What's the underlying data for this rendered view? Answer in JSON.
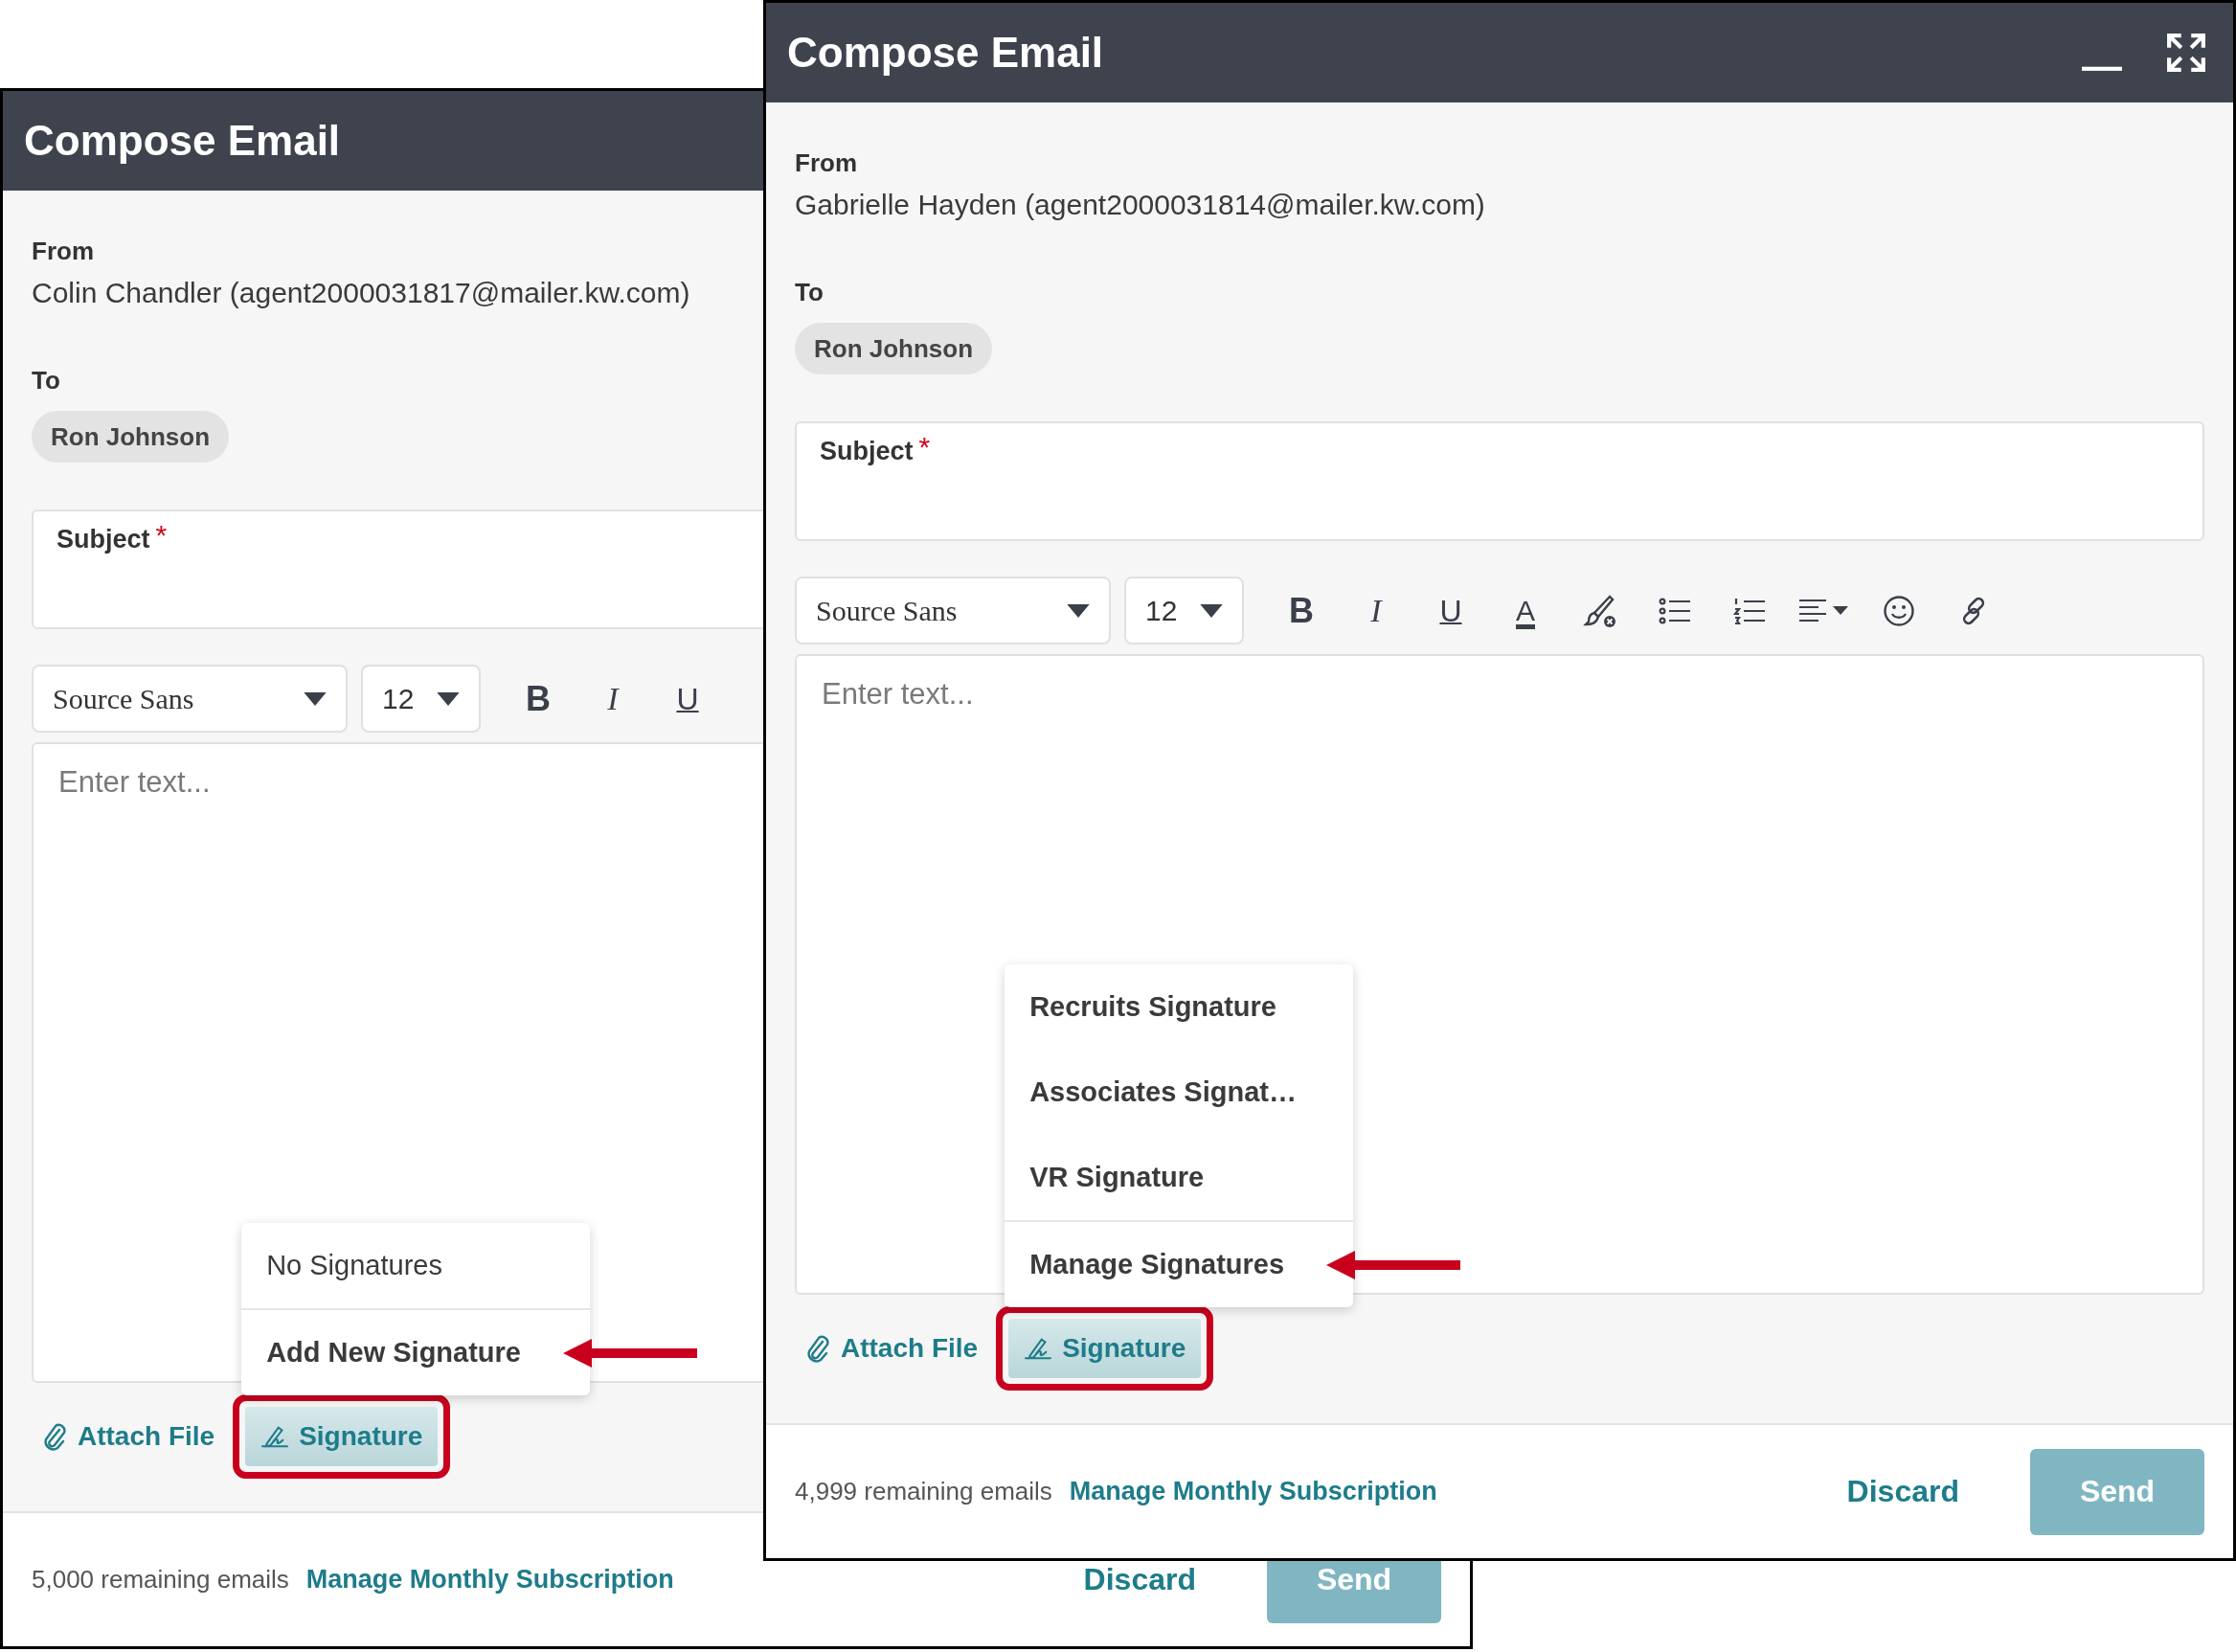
{
  "windows": [
    {
      "title": "Compose Email",
      "from_label": "From",
      "from": "Colin Chandler (agent2000031817@mailer.kw.com)",
      "to_label": "To",
      "recipients": [
        "Ron Johnson"
      ],
      "subject": {
        "label": "Subject",
        "required_mark": "*"
      },
      "font": "Source Sans",
      "size": "12",
      "toolbar": [
        {
          "kind": "bold",
          "glyph": "B"
        },
        {
          "kind": "italic",
          "glyph": "I"
        },
        {
          "kind": "underline",
          "glyph": "U"
        }
      ],
      "editor": {
        "placeholder": "Enter text..."
      },
      "attach": "Attach File",
      "signature": {
        "label": "Signature",
        "highlighted": true,
        "menu": [
          {
            "label": "No Signatures",
            "kind": "empty",
            "pointed": false
          },
          {
            "label": "Add New Signature",
            "kind": "action",
            "pointed": true
          }
        ]
      },
      "footer": {
        "remaining": "5,000 remaining emails",
        "link": "Manage Monthly Subscription",
        "discard": "Discard",
        "send": "Send"
      }
    },
    {
      "title": "Compose Email",
      "window_controls": [
        {
          "kind": "minimize"
        },
        {
          "kind": "expand"
        }
      ],
      "from_label": "From",
      "from": "Gabrielle Hayden (agent2000031814@mailer.kw.com)",
      "to_label": "To",
      "recipients": [
        "Ron Johnson"
      ],
      "subject": {
        "label": "Subject",
        "required_mark": "*"
      },
      "font": "Source Sans",
      "size": "12",
      "toolbar": [
        {
          "kind": "bold",
          "glyph": "B"
        },
        {
          "kind": "italic",
          "glyph": "I"
        },
        {
          "kind": "underline",
          "glyph": "U"
        },
        {
          "kind": "text-color",
          "glyph": "A"
        },
        {
          "kind": "highlight"
        },
        {
          "kind": "bullets"
        },
        {
          "kind": "numbers"
        },
        {
          "kind": "align"
        },
        {
          "kind": "emoji"
        },
        {
          "kind": "link"
        }
      ],
      "editor": {
        "placeholder": "Enter text..."
      },
      "attach": "Attach File",
      "signature": {
        "label": "Signature",
        "highlighted": true,
        "menu": [
          {
            "label": "Recruits Signature",
            "kind": "signature",
            "pointed": false
          },
          {
            "label": "Associates Signat…",
            "kind": "signature",
            "pointed": false
          },
          {
            "label": "VR Signature",
            "kind": "signature",
            "pointed": false
          },
          {
            "label": "Manage Signatures",
            "kind": "action",
            "pointed": true
          }
        ]
      },
      "footer": {
        "remaining": "4,999 remaining emails",
        "link": "Manage Monthly Subscription",
        "discard": "Discard",
        "send": "Send"
      }
    }
  ]
}
